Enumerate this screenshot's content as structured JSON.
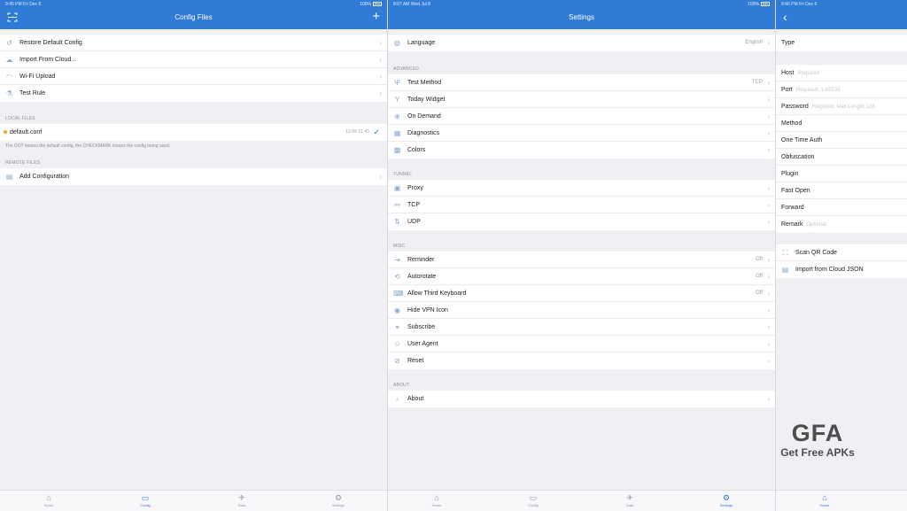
{
  "panel1": {
    "status": {
      "time": "9:45 PM   Fri Dec 6",
      "battery": "100%"
    },
    "title": "Config Files",
    "add_icon": "plus-icon",
    "menu": [
      {
        "label": "Restore Default Config",
        "icon": "restore-icon"
      },
      {
        "label": "Import From Cloud...",
        "icon": "cloud-icon"
      },
      {
        "label": "Wi-Fi Upload",
        "icon": "wifi-icon"
      },
      {
        "label": "Test Rule",
        "icon": "test-icon"
      }
    ],
    "local_header": "LOCAL FILES",
    "local_file": {
      "name": "default.conf",
      "date": "12-06 21:45"
    },
    "note": "The DOT means the default config, the CHECKMARK means the config being used.",
    "remote_header": "REMOTE FILES",
    "add_config": "Add Configuration"
  },
  "panel2": {
    "status": {
      "time": "8:07 AM   Wed Jul 8",
      "battery": "100%"
    },
    "title": "Settings",
    "language": {
      "label": "Language",
      "value": "English"
    },
    "advanced_header": "ADVANCED",
    "advanced": [
      {
        "label": "Test Method",
        "value": "TCP",
        "icon": "antenna-icon"
      },
      {
        "label": "Today Widget",
        "value": "",
        "icon": "widget-icon"
      },
      {
        "label": "On Demand",
        "value": "",
        "icon": "on-demand-icon"
      },
      {
        "label": "Diagnostics",
        "value": "",
        "icon": "diagnostics-icon"
      },
      {
        "label": "Colors",
        "value": "",
        "icon": "colors-icon"
      }
    ],
    "tunnel_header": "TUNNEL",
    "tunnel": [
      {
        "label": "Proxy",
        "icon": "proxy-icon"
      },
      {
        "label": "TCP",
        "icon": "tcp-icon"
      },
      {
        "label": "UDP",
        "icon": "udp-icon"
      }
    ],
    "misc_header": "MISC",
    "misc": [
      {
        "label": "Reminder",
        "value": "Off",
        "icon": "reminder-icon"
      },
      {
        "label": "Autorotate",
        "value": "Off",
        "icon": "rotate-icon"
      },
      {
        "label": "Allow Third Keyboard",
        "value": "Off",
        "icon": "keyboard-icon"
      },
      {
        "label": "Hide VPN Icon",
        "value": "",
        "icon": "vpn-icon"
      },
      {
        "label": "Subscribe",
        "value": "",
        "icon": "link-icon"
      },
      {
        "label": "User Agent",
        "value": "",
        "icon": "user-agent-icon"
      },
      {
        "label": "Reset",
        "value": "",
        "icon": "reset-icon"
      }
    ],
    "about_header": "ABOUT",
    "about": "About"
  },
  "panel3": {
    "status": {
      "time": "9:46 PM   Fri Dec 6"
    },
    "type_label": "Type",
    "fields": [
      {
        "label": "Host",
        "placeholder": "Required"
      },
      {
        "label": "Port",
        "placeholder": "Required, 1-65535"
      },
      {
        "label": "Password",
        "placeholder": "Required, Max Lenght 128"
      },
      {
        "label": "Method",
        "placeholder": ""
      },
      {
        "label": "One Time Auth",
        "placeholder": ""
      },
      {
        "label": "Obfuscation",
        "placeholder": ""
      },
      {
        "label": "Plugin",
        "placeholder": ""
      },
      {
        "label": "Fast Open",
        "placeholder": ""
      },
      {
        "label": "Forward",
        "placeholder": ""
      },
      {
        "label": "Remark",
        "placeholder": "Optional"
      }
    ],
    "actions": [
      {
        "label": "Scan QR Code",
        "icon": "qr-icon"
      },
      {
        "label": "Import from Cloud JSON",
        "icon": "cloud-json-icon"
      }
    ]
  },
  "tabs": [
    "Home",
    "Config",
    "Data",
    "Settings"
  ],
  "watermark": {
    "logo": "GFA",
    "tagline": "Get Free APKs"
  },
  "colors": {
    "accent": "#2f7bd6",
    "background": "#efeff4",
    "dot": "#f5a623"
  }
}
